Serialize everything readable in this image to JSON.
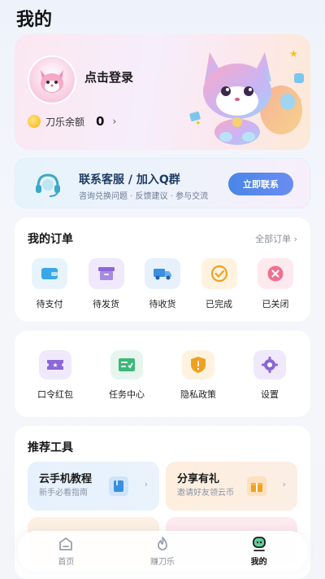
{
  "page": {
    "title": "我的"
  },
  "profile": {
    "login_text": "点击登录",
    "balance_label": "刀乐余额",
    "balance_value": "0",
    "chevron": "›"
  },
  "contact": {
    "title": "联系客服 / 加入Q群",
    "subtitle": "咨询兑换问题 · 反馈建议 · 参与交流",
    "button": "立即联系"
  },
  "orders": {
    "title": "我的订单",
    "all_link": "全部订单 ›",
    "items": [
      {
        "label": "待支付",
        "icon": "wallet-icon",
        "color": "#3aa8e8",
        "bg": "#e7f4fc"
      },
      {
        "label": "待发货",
        "icon": "box-icon",
        "color": "#8b67d8",
        "bg": "#efe9fb"
      },
      {
        "label": "待收货",
        "icon": "truck-icon",
        "color": "#3a8fe0",
        "bg": "#e6f1fc"
      },
      {
        "label": "已完成",
        "icon": "check-circle-icon",
        "color": "#f0a020",
        "bg": "#fff3e0"
      },
      {
        "label": "已关闭",
        "icon": "close-circle-icon",
        "color": "#f06080",
        "bg": "#fde9ee"
      }
    ]
  },
  "services": {
    "items": [
      {
        "label": "口令红包",
        "icon": "ticket-icon",
        "color": "#8b67d8",
        "bg": "#efe9fb"
      },
      {
        "label": "任务中心",
        "icon": "task-list-icon",
        "color": "#3cb878",
        "bg": "#e6f6ee"
      },
      {
        "label": "隐私政策",
        "icon": "shield-icon",
        "color": "#f0a020",
        "bg": "#fff3e0"
      },
      {
        "label": "设置",
        "icon": "gear-icon",
        "color": "#8b67d8",
        "bg": "#efe9fb"
      }
    ]
  },
  "tools": {
    "title": "推荐工具",
    "items": [
      {
        "title": "云手机教程",
        "subtitle": "新手必看指南",
        "icon": "book-icon",
        "color": "#3a8fe0"
      },
      {
        "title": "分享有礼",
        "subtitle": "邀请好友领云币",
        "icon": "gift-icon",
        "color": "#f0a020"
      }
    ]
  },
  "nav": {
    "items": [
      {
        "label": "首页",
        "icon": "home-icon"
      },
      {
        "label": "赚刀乐",
        "icon": "flame-icon"
      },
      {
        "label": "我的",
        "icon": "user-icon"
      }
    ]
  },
  "colors": {
    "accent": "#4a86e8",
    "text": "#1b1b1b",
    "muted": "#8a8f99"
  }
}
